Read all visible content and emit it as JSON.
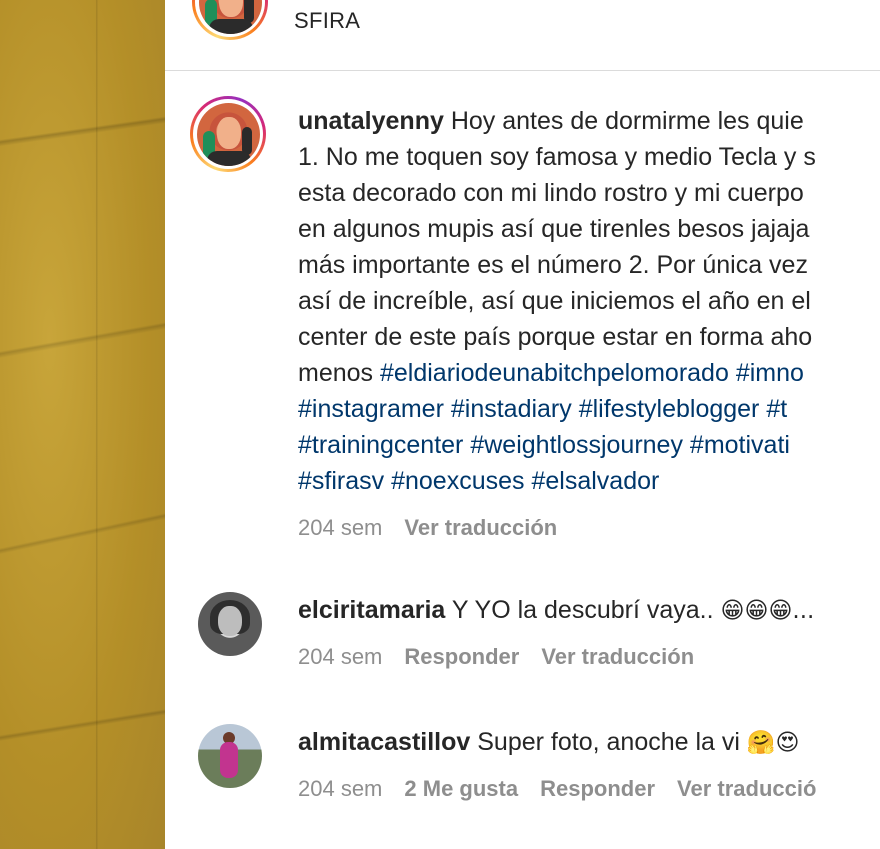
{
  "header": {
    "username": "SFIRA"
  },
  "post": {
    "username": "unatalyenny",
    "caption_lines": [
      " Hoy antes de dormirme les quie",
      "1. No me toquen soy famosa y medio Tecla y s",
      "esta decorado con mi lindo rostro y mi cuerpo",
      "en algunos mupis así que tirenles besos jajaja",
      "más importante es el número 2. Por única vez",
      "así de increíble, así que iniciemos el año en el",
      "center de este país porque estar en forma aho"
    ],
    "line8_prefix": "menos ",
    "hashtags": {
      "l8": [
        "#eldiariodeunabitchpelomorado",
        "#imno"
      ],
      "l9": [
        "#instagramer",
        "#instadiary",
        "#lifestyleblogger",
        "#t"
      ],
      "l10": [
        "#trainingcenter",
        "#weightlossjourney",
        "#motivati"
      ],
      "l11": [
        "#sfirasv",
        "#noexcuses",
        "#elsalvador"
      ]
    },
    "time": "204 sem",
    "translate": "Ver traducción"
  },
  "comments": [
    {
      "username": "elciritamaria",
      "text": " Y YO la descubrí vaya.. ",
      "emoji": "😁😁😁...",
      "time": "204 sem",
      "reply": "Responder",
      "translate": "Ver traducción"
    },
    {
      "username": "almitacastillov",
      "text": " Super foto, anoche la vi ",
      "emoji": "🤗😍",
      "time": "204 sem",
      "likes": "2 Me gusta",
      "reply": "Responder",
      "translate": "Ver traducció"
    }
  ],
  "colors": {
    "hashtag": "#00376b",
    "muted": "#8e8e8e",
    "text": "#262626"
  }
}
